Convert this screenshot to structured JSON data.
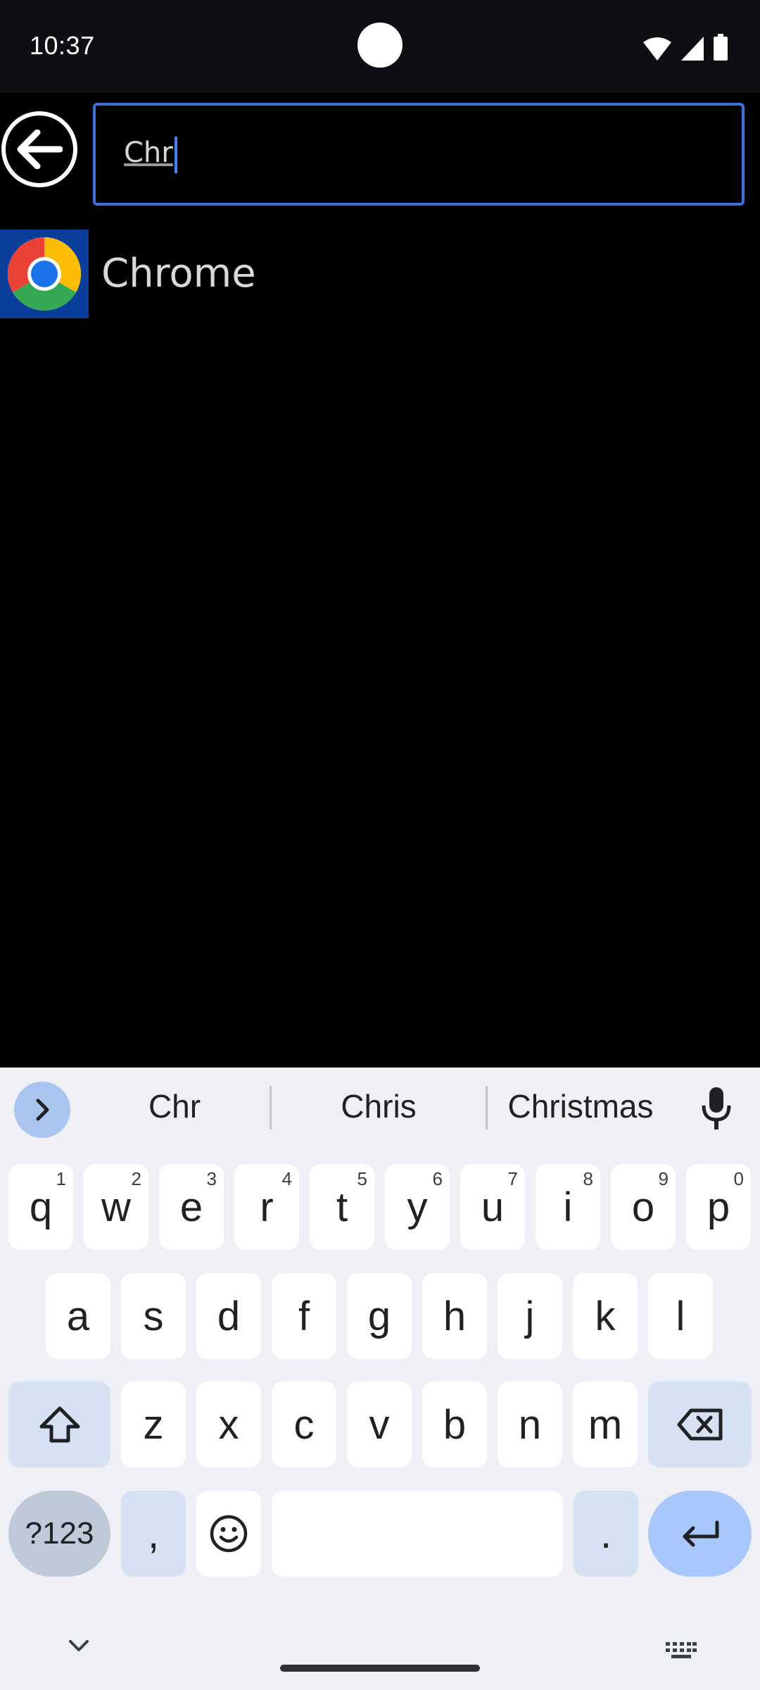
{
  "status_bar": {
    "time": "10:37",
    "icons": [
      "wifi-icon",
      "signal-icon",
      "battery-icon"
    ]
  },
  "header": {
    "back_icon": "arrow-left-icon",
    "search": {
      "value": "Chr"
    }
  },
  "results": [
    {
      "label": "Chrome",
      "icon": "chrome-icon"
    }
  ],
  "keyboard": {
    "suggestions": [
      "Chr",
      "Chris",
      "Christmas"
    ],
    "row1": [
      {
        "key": "q",
        "hint": "1"
      },
      {
        "key": "w",
        "hint": "2"
      },
      {
        "key": "e",
        "hint": "3"
      },
      {
        "key": "r",
        "hint": "4"
      },
      {
        "key": "t",
        "hint": "5"
      },
      {
        "key": "y",
        "hint": "6"
      },
      {
        "key": "u",
        "hint": "7"
      },
      {
        "key": "i",
        "hint": "8"
      },
      {
        "key": "o",
        "hint": "9"
      },
      {
        "key": "p",
        "hint": "0"
      }
    ],
    "row2": [
      "a",
      "s",
      "d",
      "f",
      "g",
      "h",
      "j",
      "k",
      "l"
    ],
    "row3": [
      "z",
      "x",
      "c",
      "v",
      "b",
      "n",
      "m"
    ],
    "symbols_label": "?123",
    "comma_label": ",",
    "period_label": "."
  },
  "colors": {
    "accent": "#3f6fd8",
    "keyboard_bg": "#eef0f5",
    "enter_key": "#a8c7fa"
  }
}
